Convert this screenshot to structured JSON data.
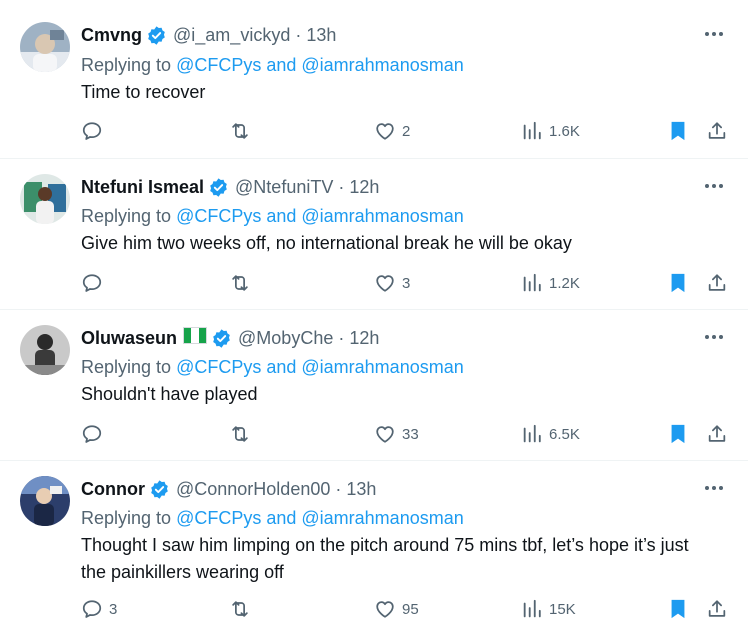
{
  "replying_label": "Replying to",
  "and_label": "and",
  "colors": {
    "accent": "#1d9bf0",
    "text": "#0f1419",
    "muted": "#536471",
    "divider": "#eff3f4"
  },
  "tweets": [
    {
      "name": "Cmvng",
      "handle": "@i_am_vickyd",
      "time": "13h",
      "mentions": [
        "@CFCPys",
        "@iamrahmanosman"
      ],
      "text": "Time to recover",
      "replies": "",
      "likes": "2",
      "views": "1.6K",
      "bookmarked": true
    },
    {
      "name": "Ntefuni Ismeal",
      "handle": "@NtefuniTV",
      "time": "12h",
      "mentions": [
        "@CFCPys",
        "@iamrahmanosman"
      ],
      "text": "Give him two weeks off, no international break he will be okay",
      "replies": "",
      "likes": "3",
      "views": "1.2K",
      "bookmarked": true
    },
    {
      "name": "Oluwaseun",
      "flag": "nigeria-flag",
      "handle": "@MobyChe",
      "time": "12h",
      "mentions": [
        "@CFCPys",
        "@iamrahmanosman"
      ],
      "text": "Shouldn't have played",
      "replies": "",
      "likes": "33",
      "views": "6.5K",
      "bookmarked": true
    },
    {
      "name": "Connor",
      "handle": "@ConnorHolden00",
      "time": "13h",
      "mentions": [
        "@CFCPys",
        "@iamrahmanosman"
      ],
      "text": "Thought I saw him limping on the pitch around 75 mins tbf, let’s hope it’s just the painkillers wearing off",
      "replies": "3",
      "likes": "95",
      "views": "15K",
      "bookmarked": true
    }
  ]
}
